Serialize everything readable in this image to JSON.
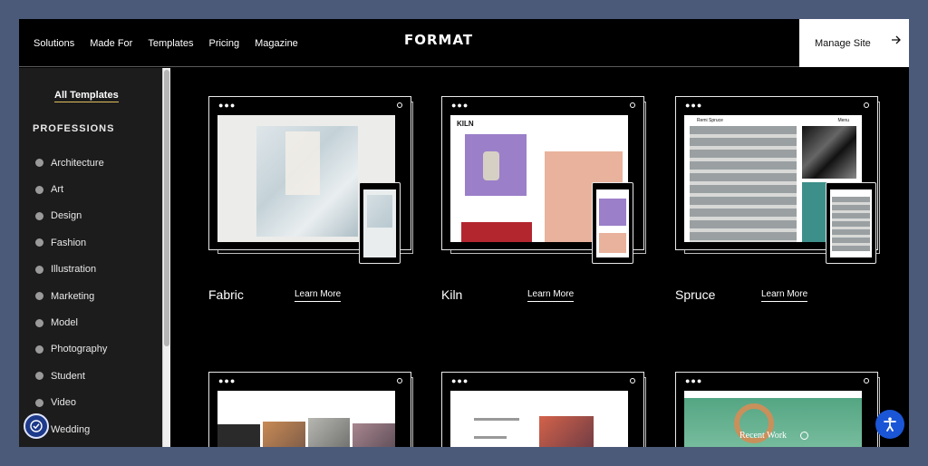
{
  "header": {
    "nav": [
      "Solutions",
      "Made For",
      "Templates",
      "Pricing",
      "Magazine"
    ],
    "logo": "FORMAT",
    "manage_label": "Manage Site",
    "manage_icon": "arrow-right-icon"
  },
  "sidebar": {
    "all_templates": "All Templates",
    "section_label": "PROFESSIONS",
    "categories": [
      "Architecture",
      "Art",
      "Design",
      "Fashion",
      "Illustration",
      "Marketing",
      "Model",
      "Photography",
      "Student",
      "Video",
      "Wedding"
    ]
  },
  "templates": [
    {
      "name": "Fabric",
      "learn": "Learn More"
    },
    {
      "name": "Kiln",
      "learn": "Learn More",
      "site_logo": "KILN"
    },
    {
      "name": "Spruce",
      "learn": "Learn More",
      "site_title": "Remi Spruce",
      "menu": "Menu"
    }
  ],
  "bottom_row": {
    "recent_work": "Recent Work"
  },
  "colors": {
    "background": "#4a5a78",
    "page": "#000000",
    "accent_underline": "#e0c060",
    "a11y_blue": "#1b56d6"
  }
}
